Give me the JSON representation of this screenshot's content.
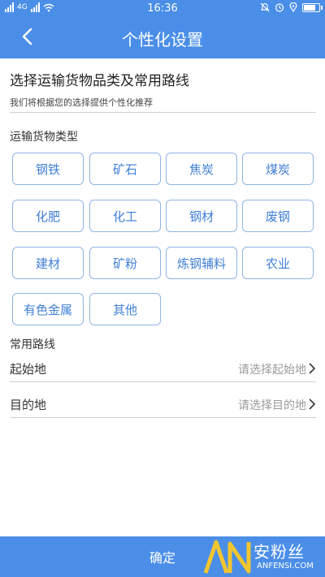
{
  "status": {
    "time": "16:36",
    "net": "4G"
  },
  "header": {
    "title": "个性化设置"
  },
  "intro": {
    "heading": "选择运输货物品类及常用路线",
    "subheading": "我们将根据您的选择提供个性化推荐"
  },
  "cargo": {
    "label": "运输货物类型",
    "items": [
      "钢铁",
      "矿石",
      "焦炭",
      "煤炭",
      "化肥",
      "化工",
      "钢材",
      "废钢",
      "建材",
      "矿粉",
      "炼钢辅料",
      "农业",
      "有色金属",
      "其他"
    ]
  },
  "routes": {
    "label": "常用路线",
    "origin": {
      "label": "起始地",
      "placeholder": "请选择起始地"
    },
    "destination": {
      "label": "目的地",
      "placeholder": "请选择目的地"
    }
  },
  "footer": {
    "confirm_label": "确定"
  },
  "watermark": {
    "cn": "安粉丝",
    "en": "ANFENSI.COM"
  },
  "colors": {
    "primary": "#4a8ee8",
    "chip_text": "#3f7fd6",
    "chip_border": "#8fb4e3"
  }
}
